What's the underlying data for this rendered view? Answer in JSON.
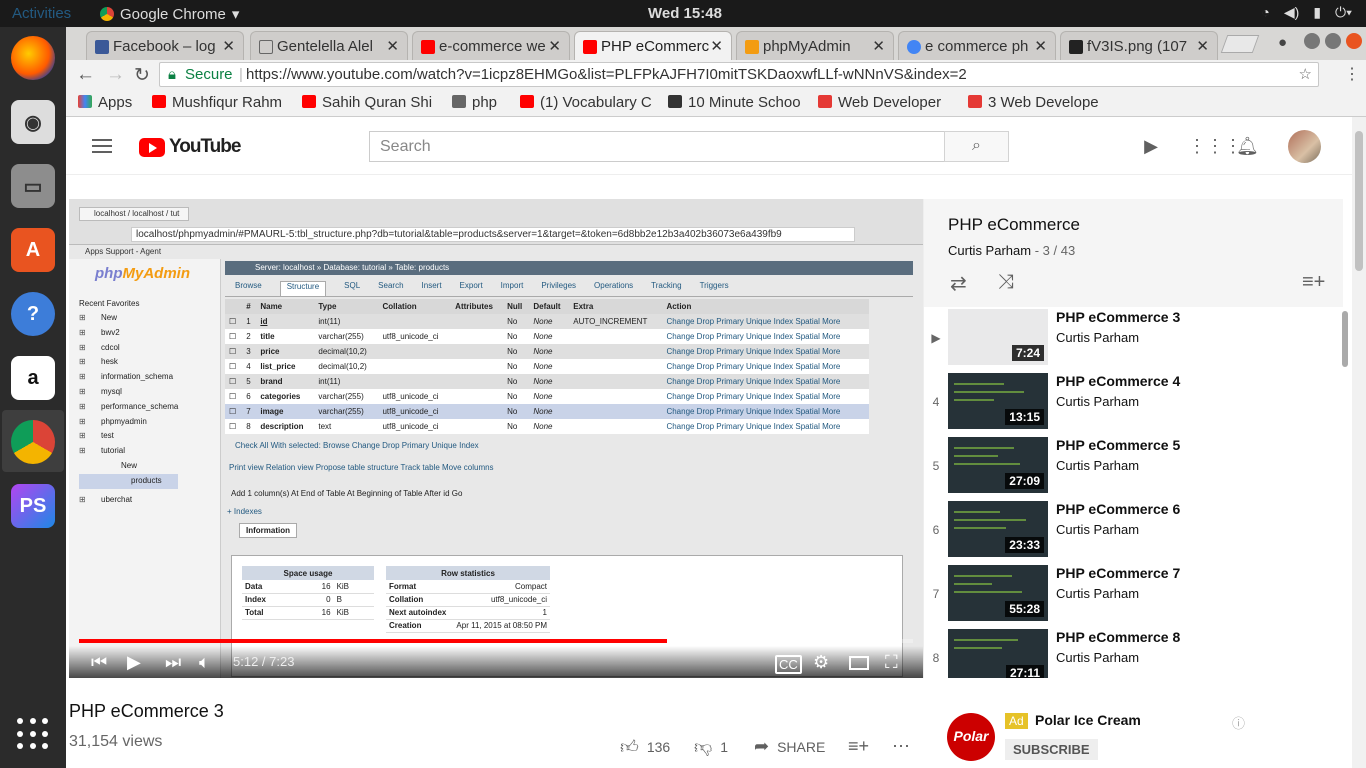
{
  "system": {
    "activities": "Activities",
    "app_name": "Google Chrome",
    "clock": "Wed 15:48"
  },
  "tabs": [
    {
      "label": "Facebook – log",
      "color": "#3b5998"
    },
    {
      "label": "Gentelella Alel",
      "color": "#888888"
    },
    {
      "label": "e-commerce we",
      "color": "#ff0000"
    },
    {
      "label": "PHP eCommerc",
      "color": "#ff0000"
    },
    {
      "label": "phpMyAdmin",
      "color": "#f39c12"
    },
    {
      "label": "e commerce ph",
      "color": "#4285f4"
    },
    {
      "label": "fV3IS.png (107",
      "color": "#222222"
    }
  ],
  "address": {
    "secure": "Secure",
    "url": "https://www.youtube.com/watch?v=1icpz8EHMGo&list=PLFPkAJFH7I0mitTSKDaoxwfLLf-wNNnVS&index=2"
  },
  "bookmarks": [
    {
      "label": "Apps",
      "color": "#e94235"
    },
    {
      "label": "Mushfiqur Rahm",
      "color": "#ff0000"
    },
    {
      "label": "Sahih Quran Shi",
      "color": "#ff0000"
    },
    {
      "label": "php",
      "color": "#666666"
    },
    {
      "label": "(1) Vocabulary C",
      "color": "#ff0000"
    },
    {
      "label": "10 Minute Schoo",
      "color": "#333333"
    },
    {
      "label": "Web Developer",
      "color": "#e53935"
    },
    {
      "label": "3 Web Develope",
      "color": "#e53935"
    }
  ],
  "youtube": {
    "search_placeholder": "Search",
    "logo": "YouTube"
  },
  "video": {
    "tab_label": "localhost / localhost / tut",
    "inner_url": "localhost/phpmyadmin/#PMAURL-5:tbl_structure.php?db=tutorial&table=products&server=1&target=&token=6d8bb2e12b3a402b36073e6a439fb9",
    "inner_bookmarks": "Apps   Support - Agent",
    "pma_logo_a": "php",
    "pma_logo_b": "MyAdmin",
    "pma_nav": "Recent   Favorites",
    "tree": [
      "New",
      "bwv2",
      "cdcol",
      "hesk",
      "information_schema",
      "mysql",
      "performance_schema",
      "phpmyadmin",
      "test",
      "tutorial",
      "New",
      "products",
      "uberchat"
    ],
    "breadcrumb": "Server: localhost » Database: tutorial » Table: products",
    "pma_tabs": [
      "Browse",
      "Structure",
      "SQL",
      "Search",
      "Insert",
      "Export",
      "Import",
      "Privileges",
      "Operations",
      "Tracking",
      "Triggers"
    ],
    "columns": [
      "#",
      "Name",
      "Type",
      "Collation",
      "Attributes",
      "Null",
      "Default",
      "Extra",
      "Action"
    ],
    "rows": [
      [
        "1",
        "id",
        "int(11)",
        "",
        "",
        "No",
        "None",
        "AUTO_INCREMENT"
      ],
      [
        "2",
        "title",
        "varchar(255)",
        "utf8_unicode_ci",
        "",
        "No",
        "None",
        ""
      ],
      [
        "3",
        "price",
        "decimal(10,2)",
        "",
        "",
        "No",
        "None",
        ""
      ],
      [
        "4",
        "list_price",
        "decimal(10,2)",
        "",
        "",
        "No",
        "None",
        ""
      ],
      [
        "5",
        "brand",
        "int(11)",
        "",
        "",
        "No",
        "None",
        ""
      ],
      [
        "6",
        "categories",
        "varchar(255)",
        "utf8_unicode_ci",
        "",
        "No",
        "None",
        ""
      ],
      [
        "7",
        "image",
        "varchar(255)",
        "utf8_unicode_ci",
        "",
        "No",
        "None",
        ""
      ],
      [
        "8",
        "description",
        "text",
        "utf8_unicode_ci",
        "",
        "No",
        "None",
        ""
      ]
    ],
    "row_actions": "Change  Drop  Primary  Unique  Index  Spatial  More",
    "with_selected": "Check All   With selected:   Browse   Change   Drop   Primary   Unique   Index",
    "links": "Print view    Relation view    Propose table structure    Track table    Move columns",
    "add_line": "Add  1  column(s)   At End of Table   At Beginning of Table   After  id   Go",
    "indexes": "+ Indexes",
    "info_tab": "Information",
    "space_usage": {
      "title": "Space usage",
      "rows": [
        [
          "Data",
          "16",
          "KiB"
        ],
        [
          "Index",
          "0",
          "B"
        ],
        [
          "Total",
          "16",
          "KiB"
        ]
      ]
    },
    "row_stats": {
      "title": "Row statistics",
      "rows": [
        [
          "Format",
          "Compact"
        ],
        [
          "Collation",
          "utf8_unicode_ci"
        ],
        [
          "Next autoindex",
          "1"
        ],
        [
          "Creation",
          "Apr 11, 2015 at 08:50 PM"
        ]
      ]
    },
    "time": "5:12 / 7:23",
    "progress": 0.705,
    "buffered": 0.86
  },
  "meta": {
    "title": "PHP eCommerce 3",
    "views": "31,154 views",
    "likes": "136",
    "dislikes": "1",
    "share": "SHARE"
  },
  "playlist": {
    "title": "PHP eCommerce",
    "channel": "Curtis Parham",
    "position": "- 3 / 43",
    "items": [
      {
        "num": "▶",
        "title": "PHP eCommerce 3",
        "channel": "Curtis Parham",
        "duration": "7:24",
        "light": true
      },
      {
        "num": "4",
        "title": "PHP eCommerce 4",
        "channel": "Curtis Parham",
        "duration": "13:15",
        "light": false
      },
      {
        "num": "5",
        "title": "PHP eCommerce 5",
        "channel": "Curtis Parham",
        "duration": "27:09",
        "light": false
      },
      {
        "num": "6",
        "title": "PHP eCommerce 6",
        "channel": "Curtis Parham",
        "duration": "23:33",
        "light": false
      },
      {
        "num": "7",
        "title": "PHP eCommerce 7",
        "channel": "Curtis Parham",
        "duration": "55:28",
        "light": false
      },
      {
        "num": "8",
        "title": "PHP eCommerce 8",
        "channel": "Curtis Parham",
        "duration": "27:11",
        "light": false
      }
    ]
  },
  "ad": {
    "badge": "Ad",
    "name": "Polar Ice Cream",
    "logo": "Polar",
    "subscribe": "SUBSCRIBE"
  }
}
